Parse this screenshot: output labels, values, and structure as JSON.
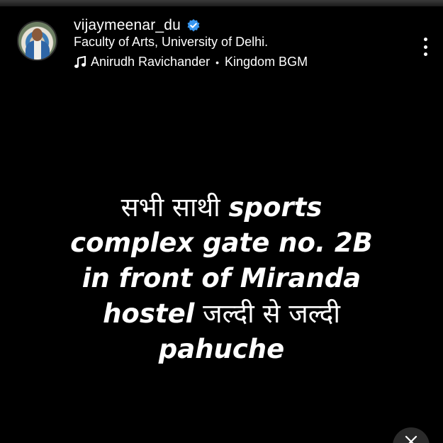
{
  "header": {
    "username": "vijaymeenar_du",
    "location": "Faculty of Arts, University of Delhi.",
    "music_artist": "Anirudh Ravichander",
    "music_separator": "•",
    "music_track": "Kingdom BGM"
  },
  "post": {
    "line1_hi": "सभी साथी",
    "line1_en": "sports",
    "line2_en": "complex gate no. 2B",
    "line3_en": "in front of Miranda",
    "line4_en": "hostel",
    "line4_hi": "जल्दी से जल्दी",
    "line5_en": "pahuche"
  },
  "icons": {
    "verified": "verified-badge-icon",
    "music": "music-note-icon",
    "more": "more-options-icon",
    "corner": "close-icon"
  },
  "colors": {
    "background": "#000000",
    "text": "#ffffff",
    "verified_blue": "#3897f0"
  }
}
